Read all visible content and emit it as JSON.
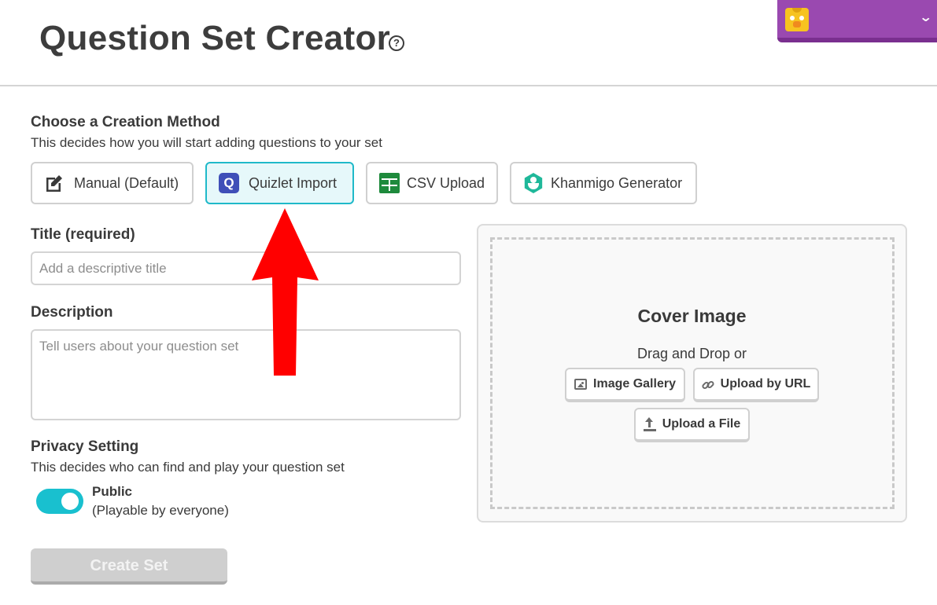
{
  "header": {
    "title": "Question Set Creator",
    "help_icon": "question-circle-icon",
    "help_glyph": "?"
  },
  "user_menu": {
    "avatar_icon": "chick-avatar-icon",
    "chevron_icon": "chevron-down-icon",
    "chevron_glyph": "⌄",
    "accent_color": "#9a49b0"
  },
  "creation_method": {
    "label": "Choose a Creation Method",
    "subtext": "This decides how you will start adding questions to your set",
    "options": [
      {
        "label": "Manual (Default)",
        "icon": "edit-icon",
        "selected": false
      },
      {
        "label": "Quizlet Import",
        "icon": "quizlet-icon",
        "glyph": "Q",
        "selected": true
      },
      {
        "label": "CSV Upload",
        "icon": "spreadsheet-icon",
        "selected": false
      },
      {
        "label": "Khanmigo Generator",
        "icon": "khanmigo-icon",
        "selected": false
      }
    ],
    "selected_color": "#1fb9c9"
  },
  "title_field": {
    "label": "Title (required)",
    "placeholder": "Add a descriptive title",
    "value": ""
  },
  "description_field": {
    "label": "Description",
    "placeholder": "Tell users about your question set",
    "value": ""
  },
  "privacy": {
    "label": "Privacy Setting",
    "subtext": "This decides who can find and play your question set",
    "toggle_on": true,
    "option_title": "Public",
    "option_sub": "(Playable by everyone)",
    "toggle_color": "#19c0cf"
  },
  "create_button": {
    "label": "Create Set",
    "disabled": true
  },
  "cover_image": {
    "title": "Cover Image",
    "subtext": "Drag and Drop or",
    "buttons": [
      {
        "label": "Image Gallery",
        "icon": "image-icon"
      },
      {
        "label": "Upload by URL",
        "icon": "link-icon",
        "glyph": "🔗"
      },
      {
        "label": "Upload a File",
        "icon": "upload-icon"
      }
    ]
  },
  "annotation": {
    "icon": "red-arrow-up-icon",
    "color": "#ff0000"
  }
}
